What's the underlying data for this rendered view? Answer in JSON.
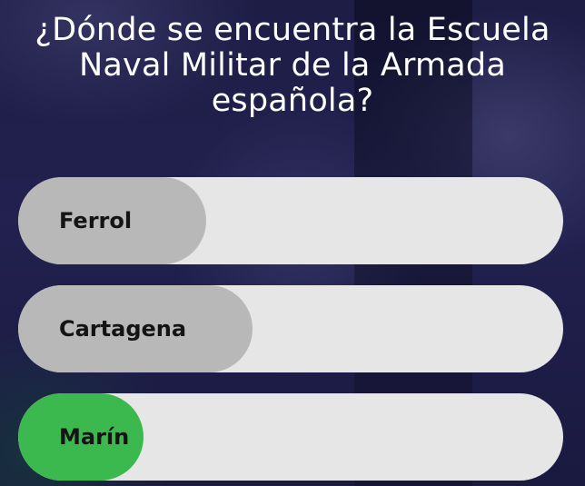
{
  "question": {
    "text": "¿Dónde se encuentra la Escuela Naval Militar de la Armada española?"
  },
  "answers": [
    {
      "label": "Ferrol",
      "fill_color": "#b8b8b8",
      "result_fraction": 0.345
    },
    {
      "label": "Cartagena",
      "fill_color": "#b8b8b8",
      "result_fraction": 0.43
    },
    {
      "label": "Marín",
      "fill_color": "#3cb94e",
      "result_fraction": 0.23
    }
  ],
  "colors": {
    "track": "#e6e6e6",
    "correct": "#3cb94e",
    "incorrect": "#b8b8b8",
    "text": "#141414",
    "question_text": "#ffffff"
  }
}
